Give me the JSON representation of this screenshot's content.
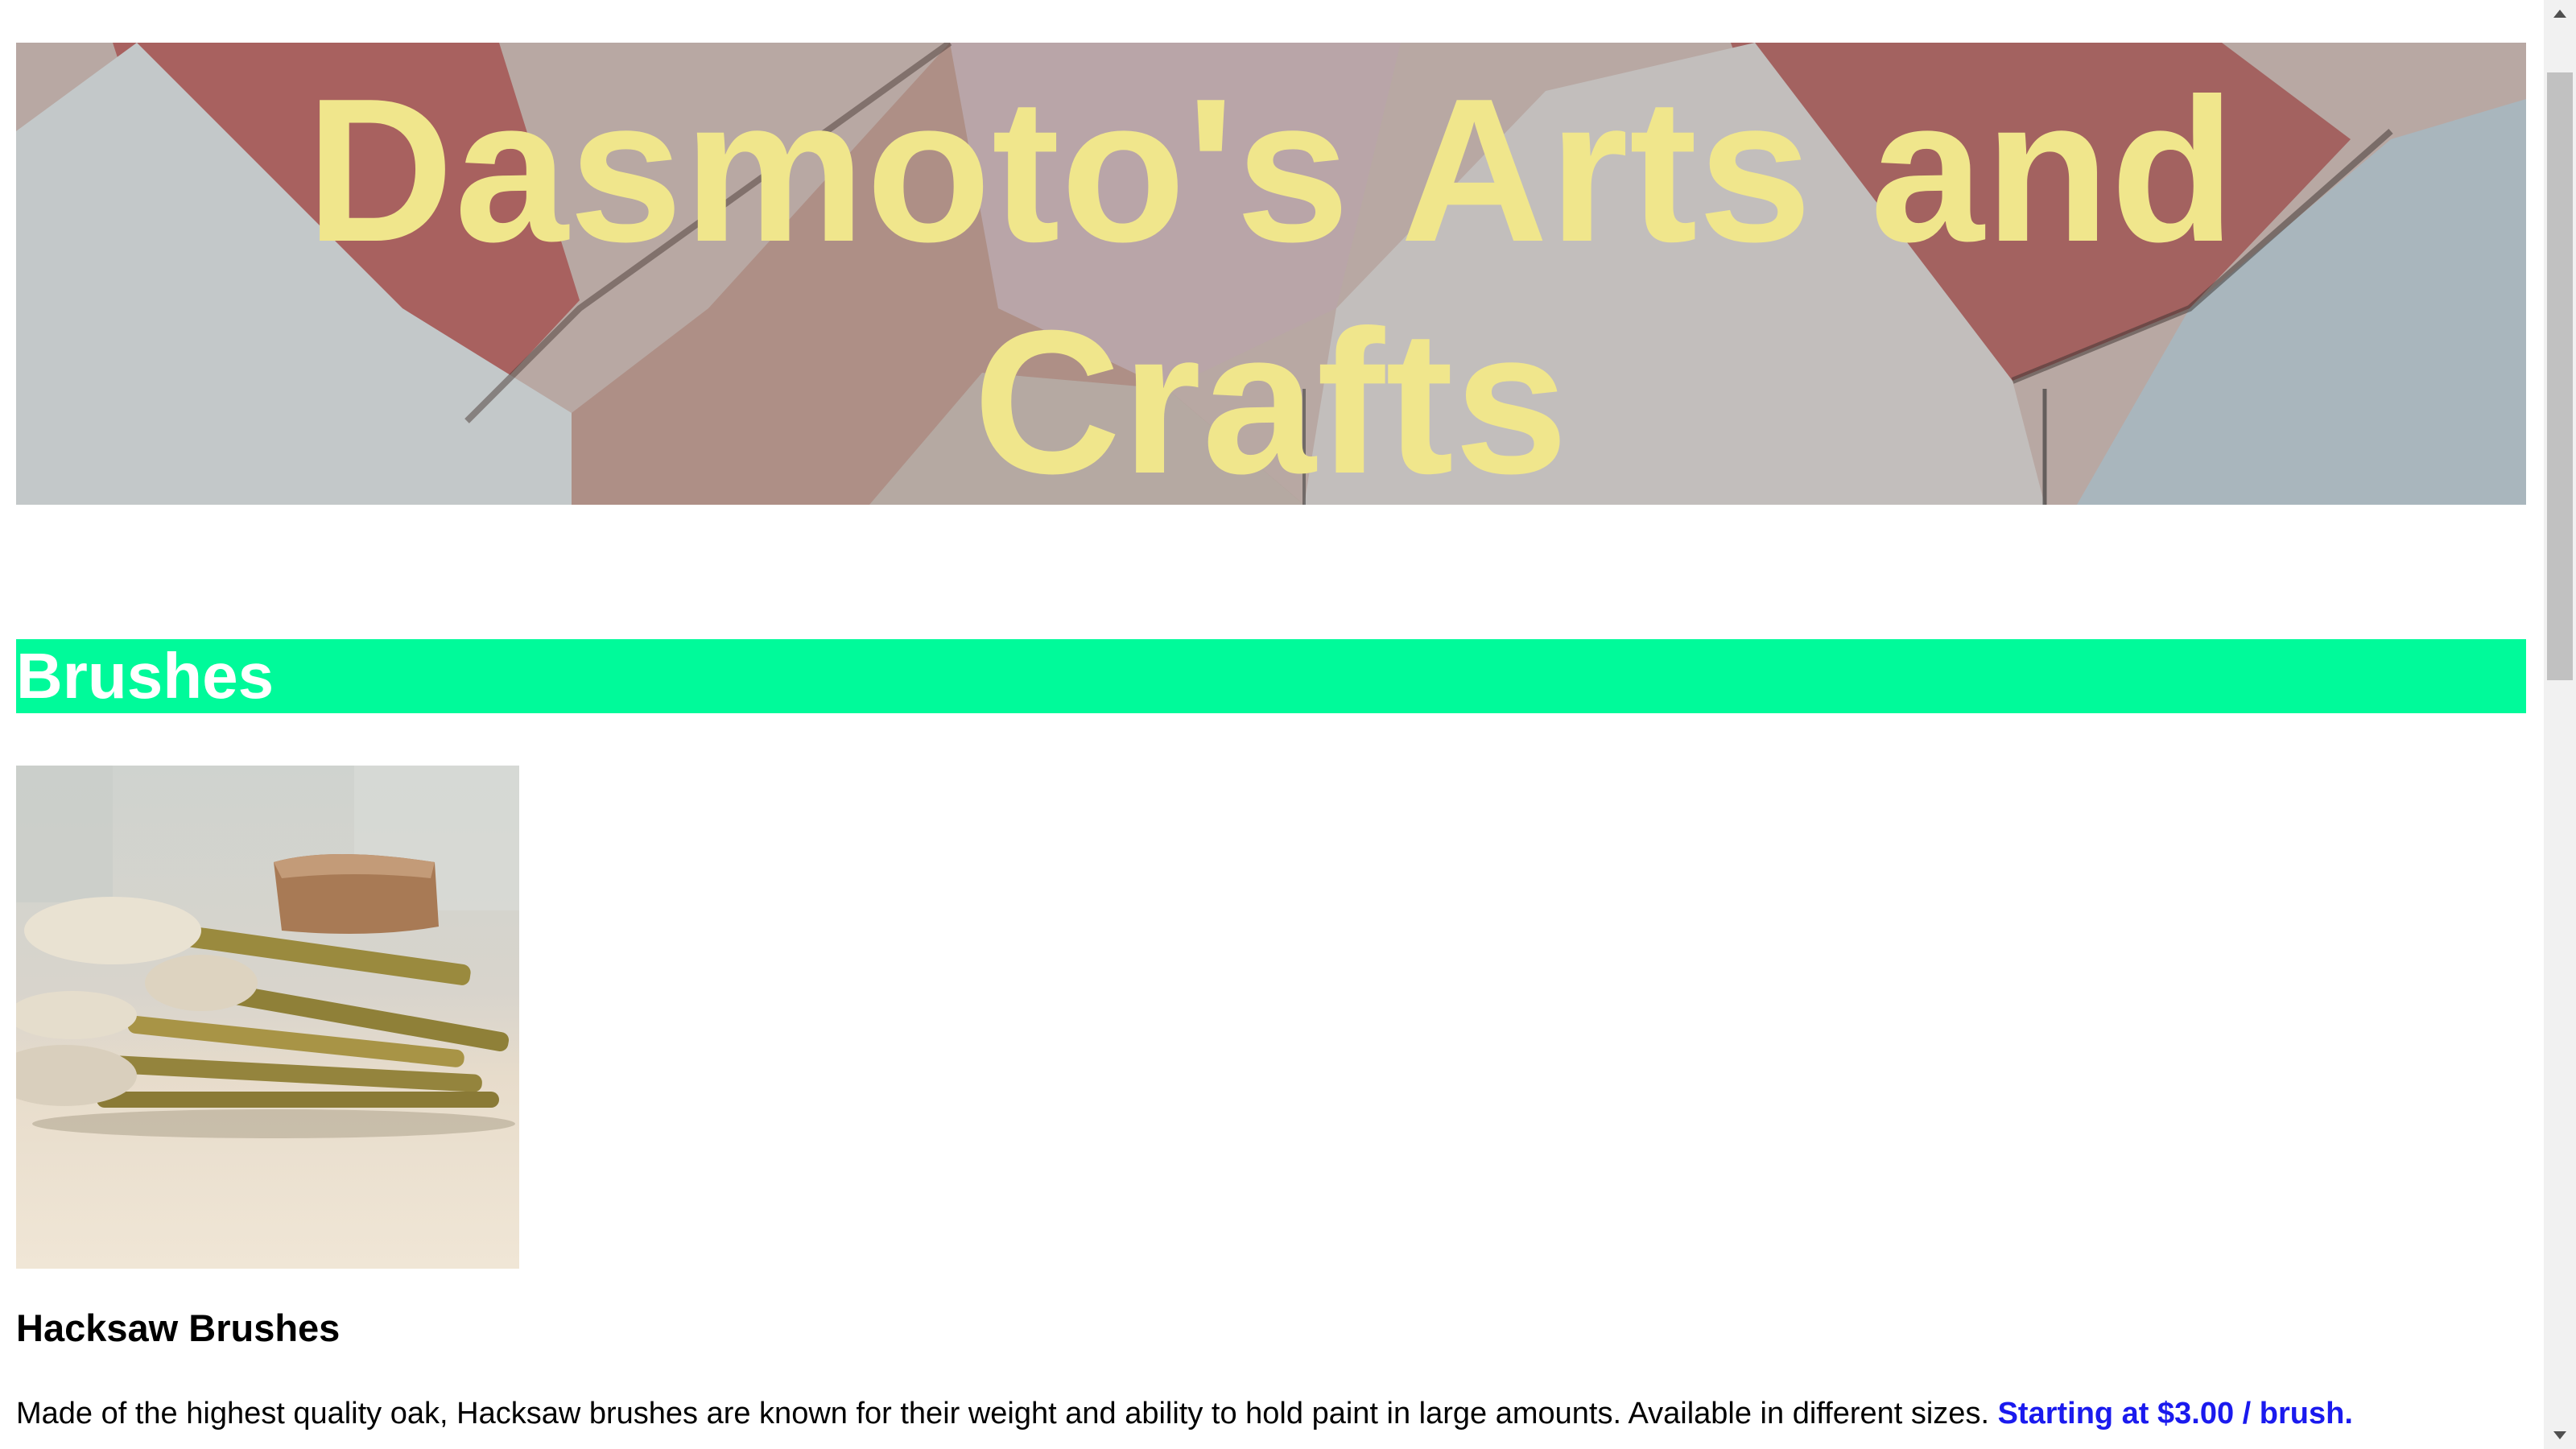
{
  "header": {
    "title": "Dasmoto's Arts and Crafts"
  },
  "sections": [
    {
      "heading": "Brushes",
      "product": {
        "image_alt": "paint brushes",
        "title": "Hacksaw Brushes",
        "description": "Made of the highest quality oak, Hacksaw brushes are known for their weight and ability to hold paint in large amounts. Available in different sizes.",
        "price": "Starting at $3.00 / brush."
      }
    }
  ],
  "colors": {
    "title_text": "#f0e68c",
    "section_bg": "#00fa9a",
    "section_text": "#ffffff",
    "price_text": "#1a1aee"
  },
  "icons": {
    "scroll_up": "triangle-up-icon",
    "scroll_down": "triangle-down-icon"
  }
}
